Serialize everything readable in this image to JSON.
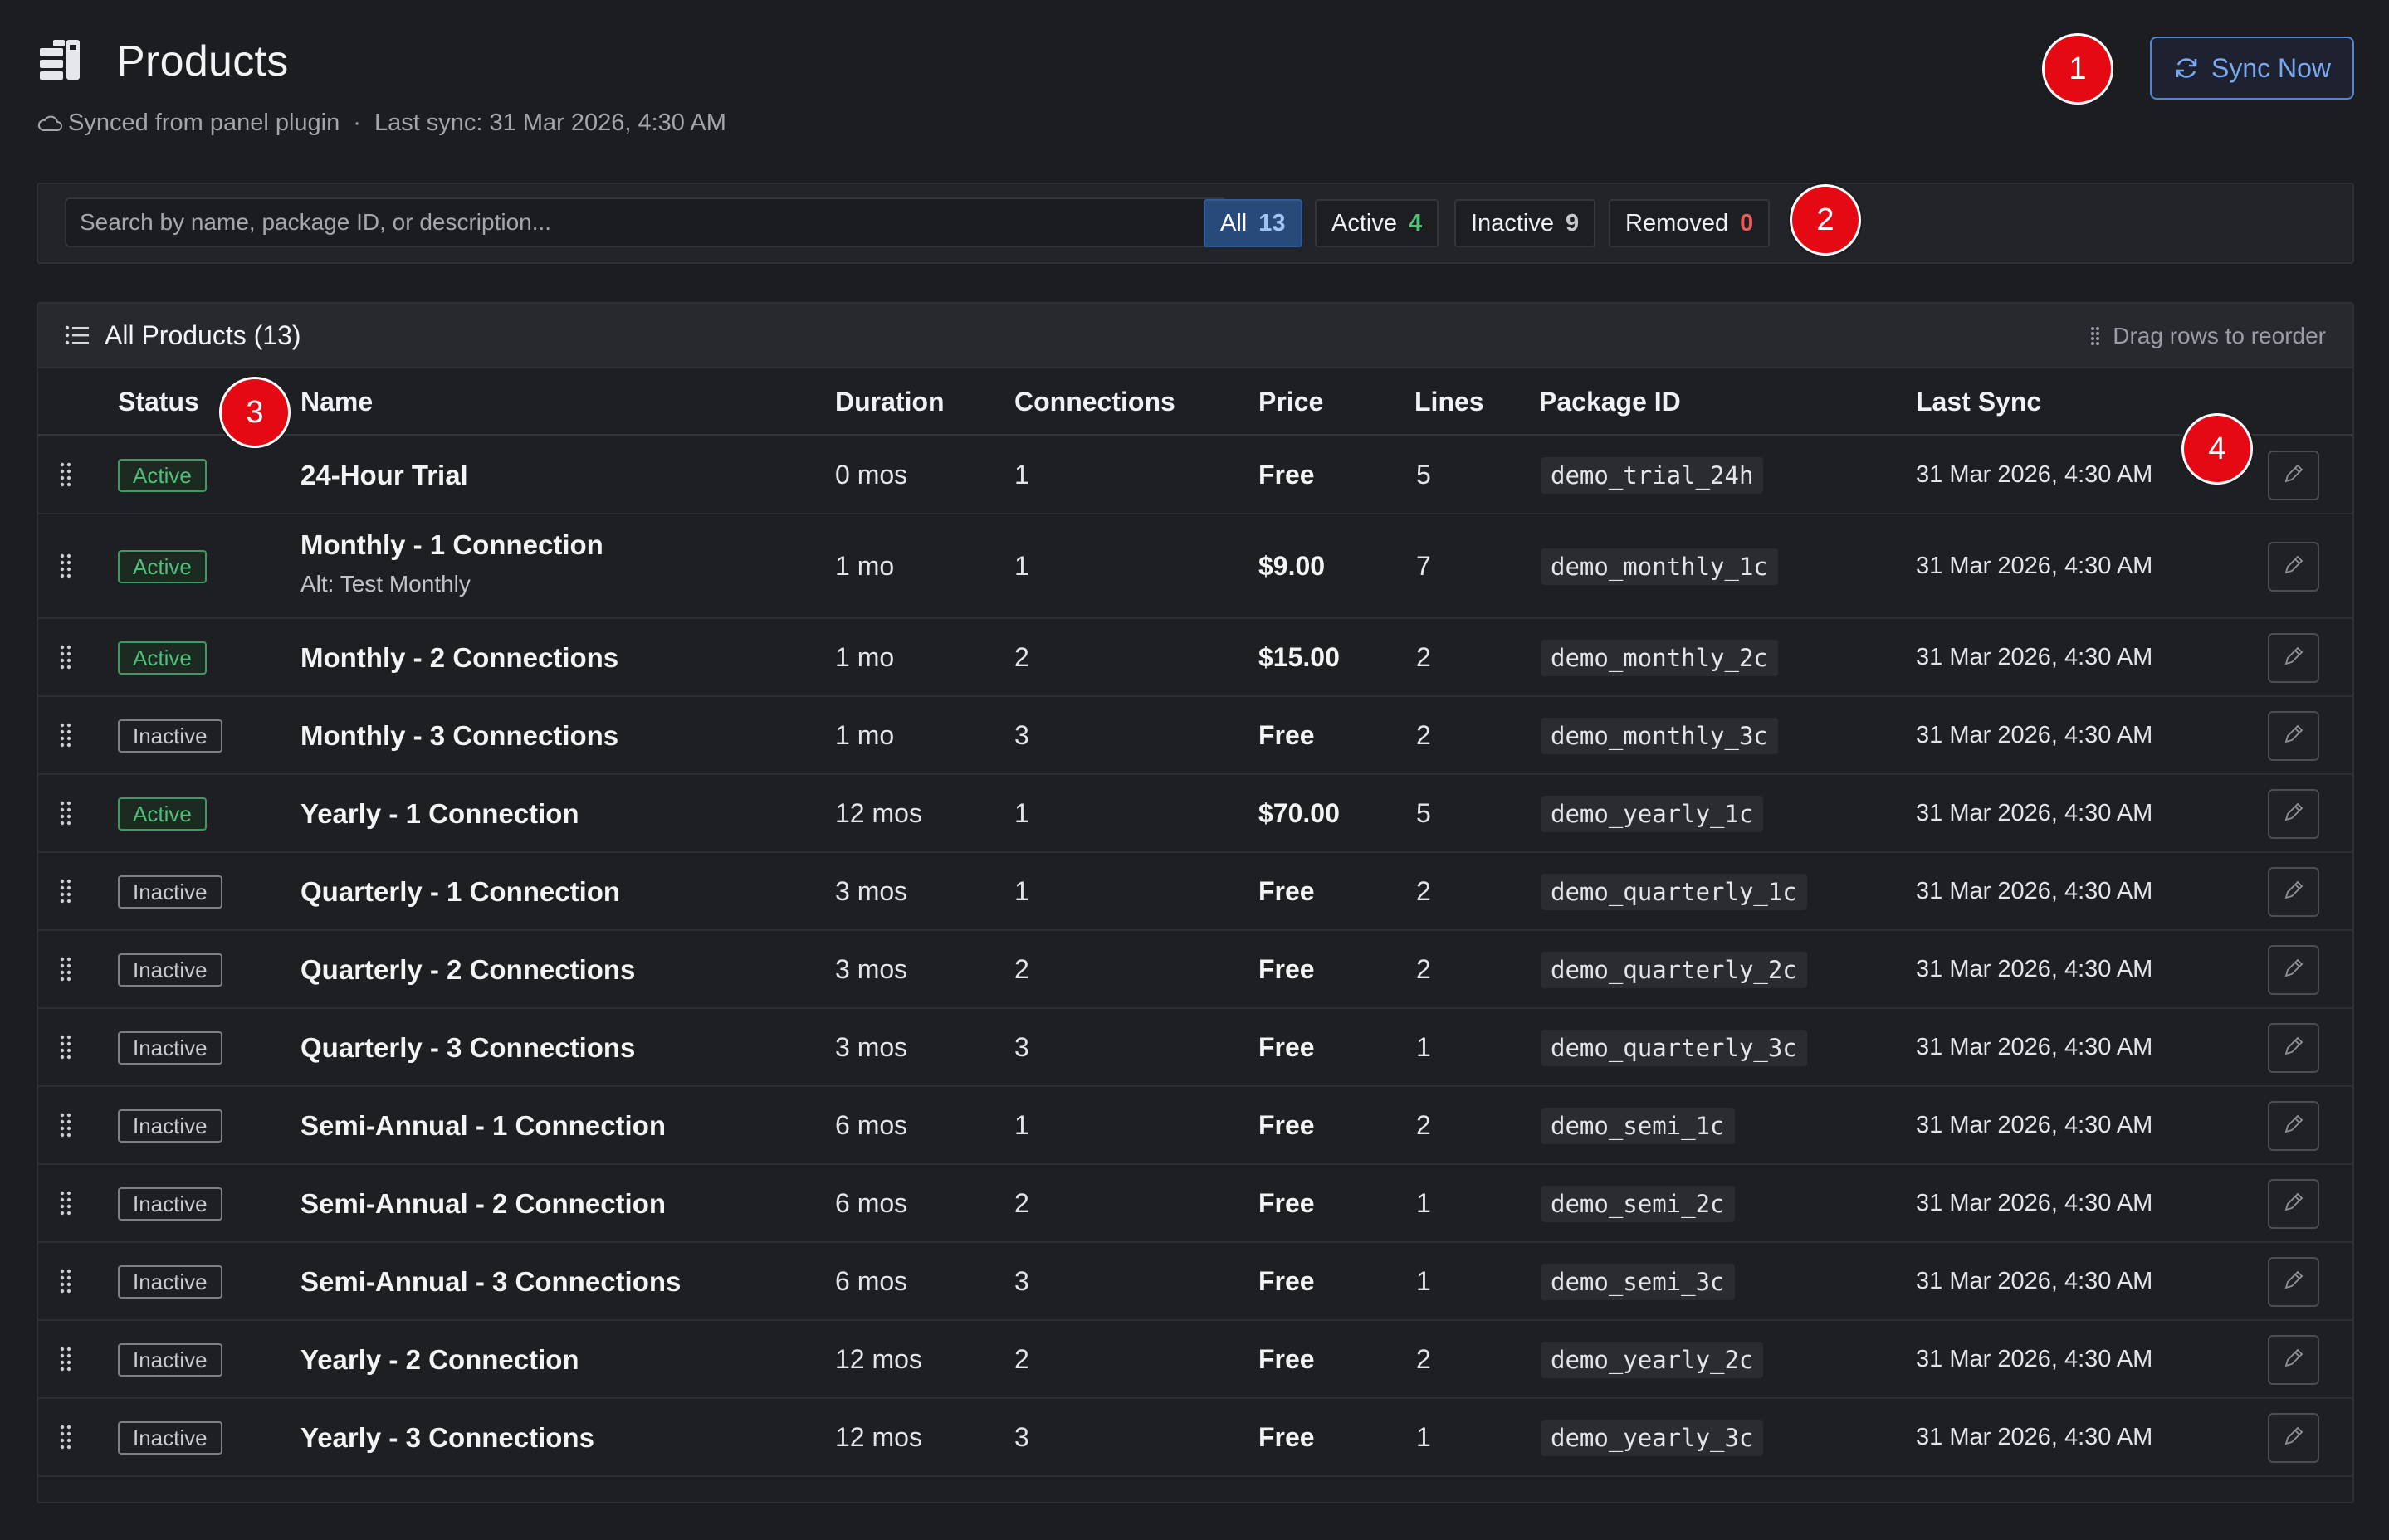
{
  "header": {
    "title": "Products",
    "subtitle_source": "Synced from panel plugin",
    "separator": "·",
    "last_sync": "Last sync: 31 Mar 2026, 4:30 AM",
    "sync_button": "Sync Now",
    "logo_icon": "server-stack-icon",
    "subtitle_icon": "cloud-icon",
    "sync_icon": "refresh-icon"
  },
  "markers": [
    "1",
    "2",
    "3",
    "4"
  ],
  "filters": {
    "search_placeholder": "Search by name, package ID, or description...",
    "search_value": "",
    "chips": [
      {
        "label": "All",
        "count": "13",
        "selected": true
      },
      {
        "label": "Active",
        "count": "4"
      },
      {
        "label": "Inactive",
        "count": "9"
      },
      {
        "label": "Removed",
        "count": "0"
      }
    ]
  },
  "table": {
    "title": "All Products (13)",
    "drag_hint": "Drag rows to reorder",
    "columns": [
      "Status",
      "Name",
      "Duration",
      "Connections",
      "Price",
      "Lines",
      "Package ID",
      "Last Sync"
    ],
    "rows": [
      {
        "status": "Active",
        "name": "24-Hour Trial",
        "alt": "",
        "duration": "0 mos",
        "connections": "1",
        "price": "Free",
        "lines": "5",
        "package_id": "demo_trial_24h",
        "last_sync": "31 Mar 2026, 4:30 AM"
      },
      {
        "status": "Active",
        "name": "Monthly - 1 Connection",
        "alt": "Alt: Test Monthly",
        "duration": "1 mo",
        "connections": "1",
        "price": "$9.00",
        "lines": "7",
        "package_id": "demo_monthly_1c",
        "last_sync": "31 Mar 2026, 4:30 AM"
      },
      {
        "status": "Active",
        "name": "Monthly - 2 Connections",
        "alt": "",
        "duration": "1 mo",
        "connections": "2",
        "price": "$15.00",
        "lines": "2",
        "package_id": "demo_monthly_2c",
        "last_sync": "31 Mar 2026, 4:30 AM"
      },
      {
        "status": "Inactive",
        "name": "Monthly - 3 Connections",
        "alt": "",
        "duration": "1 mo",
        "connections": "3",
        "price": "Free",
        "lines": "2",
        "package_id": "demo_monthly_3c",
        "last_sync": "31 Mar 2026, 4:30 AM"
      },
      {
        "status": "Active",
        "name": "Yearly - 1 Connection",
        "alt": "",
        "duration": "12 mos",
        "connections": "1",
        "price": "$70.00",
        "lines": "5",
        "package_id": "demo_yearly_1c",
        "last_sync": "31 Mar 2026, 4:30 AM"
      },
      {
        "status": "Inactive",
        "name": "Quarterly - 1 Connection",
        "alt": "",
        "duration": "3 mos",
        "connections": "1",
        "price": "Free",
        "lines": "2",
        "package_id": "demo_quarterly_1c",
        "last_sync": "31 Mar 2026, 4:30 AM"
      },
      {
        "status": "Inactive",
        "name": "Quarterly - 2 Connections",
        "alt": "",
        "duration": "3 mos",
        "connections": "2",
        "price": "Free",
        "lines": "2",
        "package_id": "demo_quarterly_2c",
        "last_sync": "31 Mar 2026, 4:30 AM"
      },
      {
        "status": "Inactive",
        "name": "Quarterly - 3 Connections",
        "alt": "",
        "duration": "3 mos",
        "connections": "3",
        "price": "Free",
        "lines": "1",
        "package_id": "demo_quarterly_3c",
        "last_sync": "31 Mar 2026, 4:30 AM"
      },
      {
        "status": "Inactive",
        "name": "Semi-Annual - 1 Connection",
        "alt": "",
        "duration": "6 mos",
        "connections": "1",
        "price": "Free",
        "lines": "2",
        "package_id": "demo_semi_1c",
        "last_sync": "31 Mar 2026, 4:30 AM"
      },
      {
        "status": "Inactive",
        "name": "Semi-Annual - 2 Connection",
        "alt": "",
        "duration": "6 mos",
        "connections": "2",
        "price": "Free",
        "lines": "1",
        "package_id": "demo_semi_2c",
        "last_sync": "31 Mar 2026, 4:30 AM"
      },
      {
        "status": "Inactive",
        "name": "Semi-Annual - 3 Connections",
        "alt": "",
        "duration": "6 mos",
        "connections": "3",
        "price": "Free",
        "lines": "1",
        "package_id": "demo_semi_3c",
        "last_sync": "31 Mar 2026, 4:30 AM"
      },
      {
        "status": "Inactive",
        "name": "Yearly - 2 Connection",
        "alt": "",
        "duration": "12 mos",
        "connections": "2",
        "price": "Free",
        "lines": "2",
        "package_id": "demo_yearly_2c",
        "last_sync": "31 Mar 2026, 4:30 AM"
      },
      {
        "status": "Inactive",
        "name": "Yearly - 3 Connections",
        "alt": "",
        "duration": "12 mos",
        "connections": "3",
        "price": "Free",
        "lines": "1",
        "package_id": "demo_yearly_3c",
        "last_sync": "31 Mar 2026, 4:30 AM"
      }
    ],
    "row_icons": {
      "drag": "drag-handle-icon",
      "edit": "pencil-icon"
    }
  },
  "colors": {
    "background": "#1c1d21",
    "accent": "#4f86d8",
    "active": "#4fbf7a",
    "removed": "#e85a5a",
    "marker": "#e50914"
  }
}
